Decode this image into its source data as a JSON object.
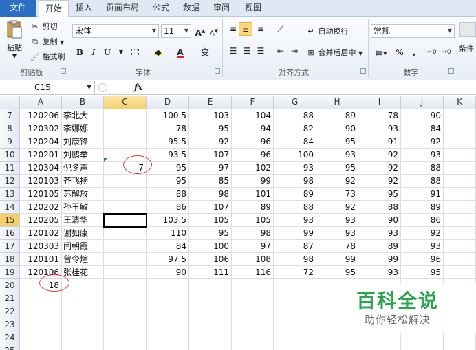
{
  "ribbon_tabs": [
    "文件",
    "开始",
    "插入",
    "页面布局",
    "公式",
    "数据",
    "审阅",
    "视图"
  ],
  "clipboard": {
    "paste": "粘贴",
    "cut": "剪切",
    "copy": "复制",
    "format_painter": "格式刷",
    "label": "剪贴板"
  },
  "font": {
    "name": "宋体",
    "size": "11",
    "grow": "A",
    "shrink": "A",
    "bold": "B",
    "italic": "I",
    "underline": "U",
    "label": "字体",
    "phonetic": "变"
  },
  "alignment": {
    "wrap_text": "自动换行",
    "merge_center": "合并后居中",
    "label": "对齐方式"
  },
  "number": {
    "format": "常规",
    "percent": "%",
    "comma": ",",
    "label": "数字"
  },
  "styles": {
    "conditional": "条件"
  },
  "formula_bar": {
    "name_box": "C15",
    "fx": "fx",
    "value": ""
  },
  "columns": [
    "A",
    "B",
    "C",
    "D",
    "E",
    "F",
    "G",
    "H",
    "I",
    "J",
    "K"
  ],
  "active_column": "C",
  "active_row": "15",
  "rows": [
    {
      "num": "7",
      "cells": [
        "120206",
        "李北大",
        "",
        "100.5",
        "103",
        "104",
        "88",
        "89",
        "78",
        "90",
        ""
      ]
    },
    {
      "num": "8",
      "cells": [
        "120302",
        "李娜娜",
        "",
        "78",
        "95",
        "94",
        "82",
        "90",
        "93",
        "84",
        ""
      ]
    },
    {
      "num": "9",
      "cells": [
        "120204",
        "刘康锋",
        "",
        "95.5",
        "92",
        "96",
        "84",
        "95",
        "91",
        "92",
        ""
      ]
    },
    {
      "num": "10",
      "cells": [
        "120201",
        "刘鹏举",
        "",
        "93.5",
        "107",
        "96",
        "100",
        "93",
        "92",
        "93",
        ""
      ]
    },
    {
      "num": "11",
      "cells": [
        "120304",
        "倪冬声",
        "7",
        "95",
        "97",
        "102",
        "93",
        "95",
        "92",
        "88",
        ""
      ]
    },
    {
      "num": "12",
      "cells": [
        "120103",
        "齐飞扬",
        "",
        "95",
        "85",
        "99",
        "98",
        "92",
        "92",
        "88",
        ""
      ]
    },
    {
      "num": "13",
      "cells": [
        "120105",
        "苏解放",
        "",
        "88",
        "98",
        "101",
        "89",
        "73",
        "95",
        "91",
        ""
      ]
    },
    {
      "num": "14",
      "cells": [
        "120202",
        "孙玉敏",
        "",
        "86",
        "107",
        "89",
        "88",
        "92",
        "88",
        "89",
        ""
      ]
    },
    {
      "num": "15",
      "cells": [
        "120205",
        "王清华",
        "",
        "103.5",
        "105",
        "105",
        "93",
        "93",
        "90",
        "86",
        ""
      ]
    },
    {
      "num": "16",
      "cells": [
        "120102",
        "谢如康",
        "",
        "110",
        "95",
        "98",
        "99",
        "93",
        "93",
        "92",
        ""
      ]
    },
    {
      "num": "17",
      "cells": [
        "120303",
        "闫朝霞",
        "",
        "84",
        "100",
        "97",
        "87",
        "78",
        "89",
        "93",
        ""
      ]
    },
    {
      "num": "18",
      "cells": [
        "120101",
        "曾令煊",
        "",
        "97.5",
        "106",
        "108",
        "98",
        "99",
        "99",
        "96",
        ""
      ]
    },
    {
      "num": "19",
      "cells": [
        "120106",
        "张桂花",
        "",
        "90",
        "111",
        "116",
        "72",
        "95",
        "93",
        "95",
        ""
      ]
    },
    {
      "num": "20",
      "cells": [
        "18",
        "",
        "",
        "",
        "",
        "",
        "",
        "",
        "",
        "",
        ""
      ]
    },
    {
      "num": "21",
      "cells": [
        "",
        "",
        "",
        "",
        "",
        "",
        "",
        "",
        "",
        "",
        ""
      ]
    },
    {
      "num": "22",
      "cells": [
        "",
        "",
        "",
        "",
        "",
        "",
        "",
        "",
        "",
        "",
        ""
      ]
    },
    {
      "num": "23",
      "cells": [
        "",
        "",
        "",
        "",
        "",
        "",
        "",
        "",
        "",
        "",
        ""
      ]
    },
    {
      "num": "24",
      "cells": [
        "",
        "",
        "",
        "",
        "",
        "",
        "",
        "",
        "",
        "",
        ""
      ]
    },
    {
      "num": "25",
      "cells": [
        "",
        "",
        "",
        "",
        "",
        "",
        "",
        "",
        "",
        "",
        ""
      ]
    }
  ],
  "watermark": {
    "title": "百科全说",
    "subtitle": "助你轻松解决"
  },
  "colors": {
    "file_tab": "#2b6fc2",
    "selection_header": "#f6cf6d",
    "annotation": "#e0393a",
    "watermark": "#2aa44f"
  }
}
